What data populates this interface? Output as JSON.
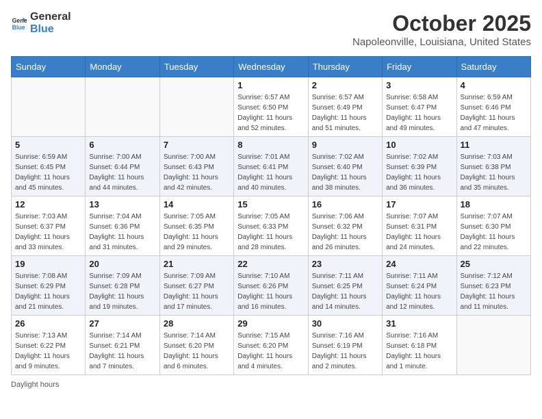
{
  "header": {
    "logo_general": "General",
    "logo_blue": "Blue",
    "title": "October 2025",
    "location": "Napoleonville, Louisiana, United States"
  },
  "weekdays": [
    "Sunday",
    "Monday",
    "Tuesday",
    "Wednesday",
    "Thursday",
    "Friday",
    "Saturday"
  ],
  "weeks": [
    [
      {
        "day": "",
        "info": ""
      },
      {
        "day": "",
        "info": ""
      },
      {
        "day": "",
        "info": ""
      },
      {
        "day": "1",
        "info": "Sunrise: 6:57 AM\nSunset: 6:50 PM\nDaylight: 11 hours and 52 minutes."
      },
      {
        "day": "2",
        "info": "Sunrise: 6:57 AM\nSunset: 6:49 PM\nDaylight: 11 hours and 51 minutes."
      },
      {
        "day": "3",
        "info": "Sunrise: 6:58 AM\nSunset: 6:47 PM\nDaylight: 11 hours and 49 minutes."
      },
      {
        "day": "4",
        "info": "Sunrise: 6:59 AM\nSunset: 6:46 PM\nDaylight: 11 hours and 47 minutes."
      }
    ],
    [
      {
        "day": "5",
        "info": "Sunrise: 6:59 AM\nSunset: 6:45 PM\nDaylight: 11 hours and 45 minutes."
      },
      {
        "day": "6",
        "info": "Sunrise: 7:00 AM\nSunset: 6:44 PM\nDaylight: 11 hours and 44 minutes."
      },
      {
        "day": "7",
        "info": "Sunrise: 7:00 AM\nSunset: 6:43 PM\nDaylight: 11 hours and 42 minutes."
      },
      {
        "day": "8",
        "info": "Sunrise: 7:01 AM\nSunset: 6:41 PM\nDaylight: 11 hours and 40 minutes."
      },
      {
        "day": "9",
        "info": "Sunrise: 7:02 AM\nSunset: 6:40 PM\nDaylight: 11 hours and 38 minutes."
      },
      {
        "day": "10",
        "info": "Sunrise: 7:02 AM\nSunset: 6:39 PM\nDaylight: 11 hours and 36 minutes."
      },
      {
        "day": "11",
        "info": "Sunrise: 7:03 AM\nSunset: 6:38 PM\nDaylight: 11 hours and 35 minutes."
      }
    ],
    [
      {
        "day": "12",
        "info": "Sunrise: 7:03 AM\nSunset: 6:37 PM\nDaylight: 11 hours and 33 minutes."
      },
      {
        "day": "13",
        "info": "Sunrise: 7:04 AM\nSunset: 6:36 PM\nDaylight: 11 hours and 31 minutes."
      },
      {
        "day": "14",
        "info": "Sunrise: 7:05 AM\nSunset: 6:35 PM\nDaylight: 11 hours and 29 minutes."
      },
      {
        "day": "15",
        "info": "Sunrise: 7:05 AM\nSunset: 6:33 PM\nDaylight: 11 hours and 28 minutes."
      },
      {
        "day": "16",
        "info": "Sunrise: 7:06 AM\nSunset: 6:32 PM\nDaylight: 11 hours and 26 minutes."
      },
      {
        "day": "17",
        "info": "Sunrise: 7:07 AM\nSunset: 6:31 PM\nDaylight: 11 hours and 24 minutes."
      },
      {
        "day": "18",
        "info": "Sunrise: 7:07 AM\nSunset: 6:30 PM\nDaylight: 11 hours and 22 minutes."
      }
    ],
    [
      {
        "day": "19",
        "info": "Sunrise: 7:08 AM\nSunset: 6:29 PM\nDaylight: 11 hours and 21 minutes."
      },
      {
        "day": "20",
        "info": "Sunrise: 7:09 AM\nSunset: 6:28 PM\nDaylight: 11 hours and 19 minutes."
      },
      {
        "day": "21",
        "info": "Sunrise: 7:09 AM\nSunset: 6:27 PM\nDaylight: 11 hours and 17 minutes."
      },
      {
        "day": "22",
        "info": "Sunrise: 7:10 AM\nSunset: 6:26 PM\nDaylight: 11 hours and 16 minutes."
      },
      {
        "day": "23",
        "info": "Sunrise: 7:11 AM\nSunset: 6:25 PM\nDaylight: 11 hours and 14 minutes."
      },
      {
        "day": "24",
        "info": "Sunrise: 7:11 AM\nSunset: 6:24 PM\nDaylight: 11 hours and 12 minutes."
      },
      {
        "day": "25",
        "info": "Sunrise: 7:12 AM\nSunset: 6:23 PM\nDaylight: 11 hours and 11 minutes."
      }
    ],
    [
      {
        "day": "26",
        "info": "Sunrise: 7:13 AM\nSunset: 6:22 PM\nDaylight: 11 hours and 9 minutes."
      },
      {
        "day": "27",
        "info": "Sunrise: 7:14 AM\nSunset: 6:21 PM\nDaylight: 11 hours and 7 minutes."
      },
      {
        "day": "28",
        "info": "Sunrise: 7:14 AM\nSunset: 6:20 PM\nDaylight: 11 hours and 6 minutes."
      },
      {
        "day": "29",
        "info": "Sunrise: 7:15 AM\nSunset: 6:20 PM\nDaylight: 11 hours and 4 minutes."
      },
      {
        "day": "30",
        "info": "Sunrise: 7:16 AM\nSunset: 6:19 PM\nDaylight: 11 hours and 2 minutes."
      },
      {
        "day": "31",
        "info": "Sunrise: 7:16 AM\nSunset: 6:18 PM\nDaylight: 11 hours and 1 minute."
      },
      {
        "day": "",
        "info": ""
      }
    ]
  ],
  "footer": {
    "daylight_label": "Daylight hours"
  }
}
